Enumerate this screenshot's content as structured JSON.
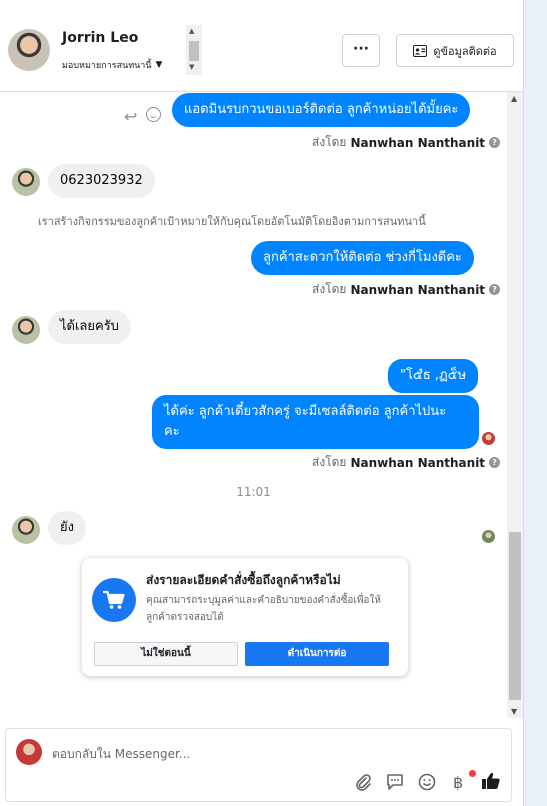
{
  "header": {
    "contact_name": "Jorrin Leo",
    "assign_label": "มอบหมายการสนทนานี้",
    "more_label": "···",
    "details_label": "ดูข้อมูลติดต่อ"
  },
  "messages": {
    "m1": "แอดมินรบกวนขอเบอร์ติดต่อ ลูกค้าหน่อยได้มั้ยคะ",
    "m2": "0623023932",
    "system": "เราสร้างกิจกรรมของลูกค้าเป้าหมายให้กับคุณโดยอัตโนมัติโดยอิงตามการสนทนานี้",
    "m3": "ลูกค้าสะดวกให้ติดต่อ ช่วงกี่โมงดีคะ",
    "m4": "ได้เลยครับ",
    "m5": "\"โ๕ํธ ,ฏ๕็ษ",
    "m6_line1": "ได้ค่ะ ลูกค้าเดี๋ยวสักครู่ จะมีเซลล์ติดต่อ ลูกค้าไปนะ",
    "m6_line2": "คะ",
    "time": "11:01",
    "m7": "ยัง"
  },
  "sent_by": {
    "prefix": "ส่งโดย",
    "name": "Nanwhan Nanthanit"
  },
  "order_card": {
    "title": "ส่งรายละเอียดคำสั่งซื้อถึงลูกค้าหรือไม่",
    "desc": "คุณสามารถระบุมูลค่าและคำอธิบายของคำสั่งซื้อเพื่อให้ลูกค้าตรวจสอบได้",
    "btn_no": "ไม่ใช่ตอนนี้",
    "btn_go": "ดำเนินการต่อ"
  },
  "composer": {
    "placeholder": "ตอบกลับใน Messenger..."
  },
  "icons": [
    "reply-icon",
    "smile-icon",
    "cart-icon",
    "contact-card-icon",
    "attach-icon",
    "sticker-icon",
    "emoji-icon",
    "baht-payment-icon",
    "like-icon"
  ],
  "colors": {
    "accent": "#0084ff",
    "brand": "#1877f2",
    "notify": "#fa383e"
  }
}
